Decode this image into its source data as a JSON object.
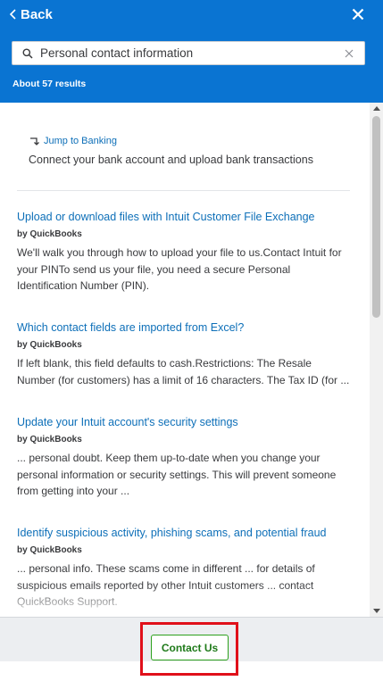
{
  "header": {
    "back_label": "Back",
    "search": {
      "value": "Personal contact information",
      "placeholder": ""
    },
    "results_count": "About 57 results"
  },
  "jump": {
    "label": "Jump to Banking",
    "description": "Connect your bank account and upload bank transactions"
  },
  "results": [
    {
      "title": "Upload or download files with Intuit Customer File Exchange",
      "by": "by QuickBooks",
      "snippet": "We'll walk you through how to upload your file to us.Contact Intuit for your PINTo send us your file, you need a secure Personal Identification Number (PIN)."
    },
    {
      "title": "Which contact fields are imported from Excel?",
      "by": "by QuickBooks",
      "snippet": "If left blank, this field defaults to cash.Restrictions: The Resale Number (for customers) has a limit of 16 characters. The Tax ID (for ..."
    },
    {
      "title": "Update your Intuit account's security settings",
      "by": "by QuickBooks",
      "snippet": "... personal doubt. Keep them up-to-date when you change your personal information or security settings. This will prevent someone from getting into your ..."
    },
    {
      "title": "Identify suspicious activity, phishing scams, and potential fraud",
      "by": "by QuickBooks",
      "snippet": "... personal info. These scams come in different ... for details of suspicious emails reported by other Intuit customers ... contact QuickBooks Support."
    }
  ],
  "footer": {
    "contact_label": "Contact Us"
  },
  "colors": {
    "header_bg": "#0a74d2",
    "link": "#0d6fb8",
    "text": "#393a3d",
    "button_border": "#2ca01c",
    "highlight": "#e0101a"
  },
  "icons": [
    "chevron-left-icon",
    "close-icon",
    "search-icon",
    "clear-icon",
    "jump-arrow-icon",
    "scroll-up-icon",
    "scroll-down-icon"
  ]
}
